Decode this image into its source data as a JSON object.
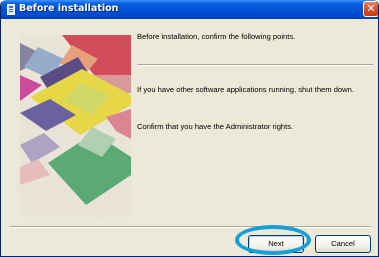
{
  "window": {
    "title": "Before installation",
    "close_glyph": "✕"
  },
  "content": {
    "intro": "Before installation, confirm the following points.",
    "point1": "If you have other software applications running, shut them down.",
    "point2": "Confirm that you have the Administrator rights."
  },
  "buttons": {
    "next_label": "Next",
    "cancel_label": "Cancel"
  },
  "icons": {
    "title_icon": "installer-icon",
    "close_icon": "close-icon"
  },
  "colors": {
    "titlebar": "#0052d6",
    "window_bg": "#ece9d8",
    "highlight_ring": "#17a0d8"
  }
}
